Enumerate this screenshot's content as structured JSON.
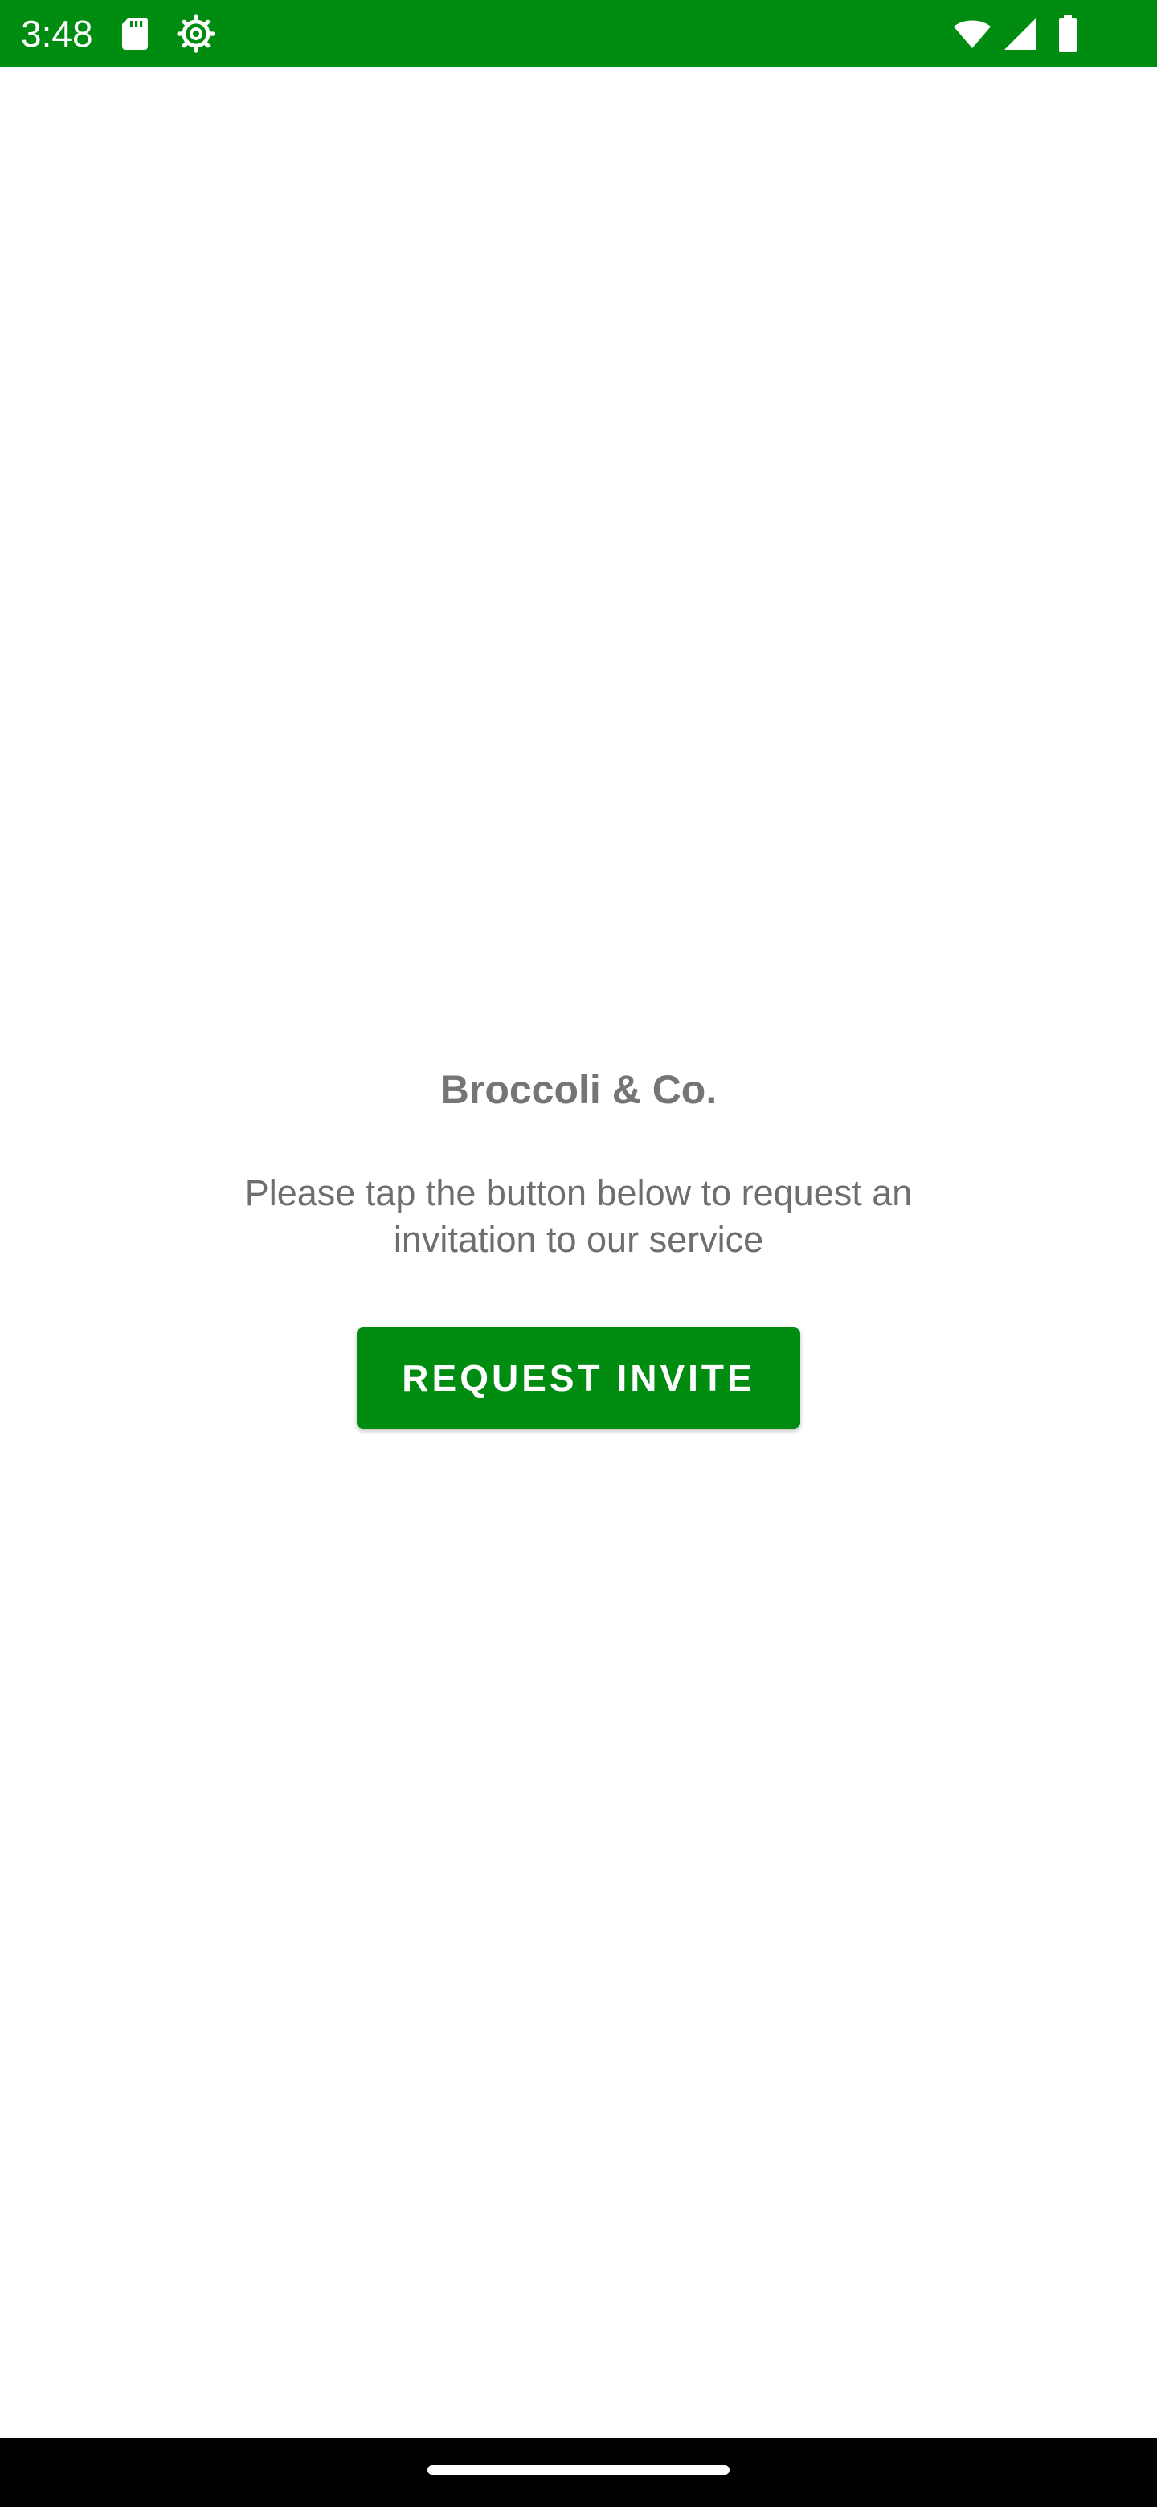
{
  "status_bar": {
    "time": "3:48",
    "background_color": "#008c11",
    "icons": [
      "sd-card-icon",
      "settings-icon",
      "wifi-icon",
      "signal-icon",
      "battery-icon"
    ]
  },
  "main": {
    "title": "Broccoli & Co.",
    "description": "Please tap the button below to request an invitation to our service",
    "request_button_label": "REQUEST INVITE",
    "accent_color": "#008c11",
    "text_color": "#757575"
  },
  "nav_bar": {
    "background_color": "#000000"
  }
}
